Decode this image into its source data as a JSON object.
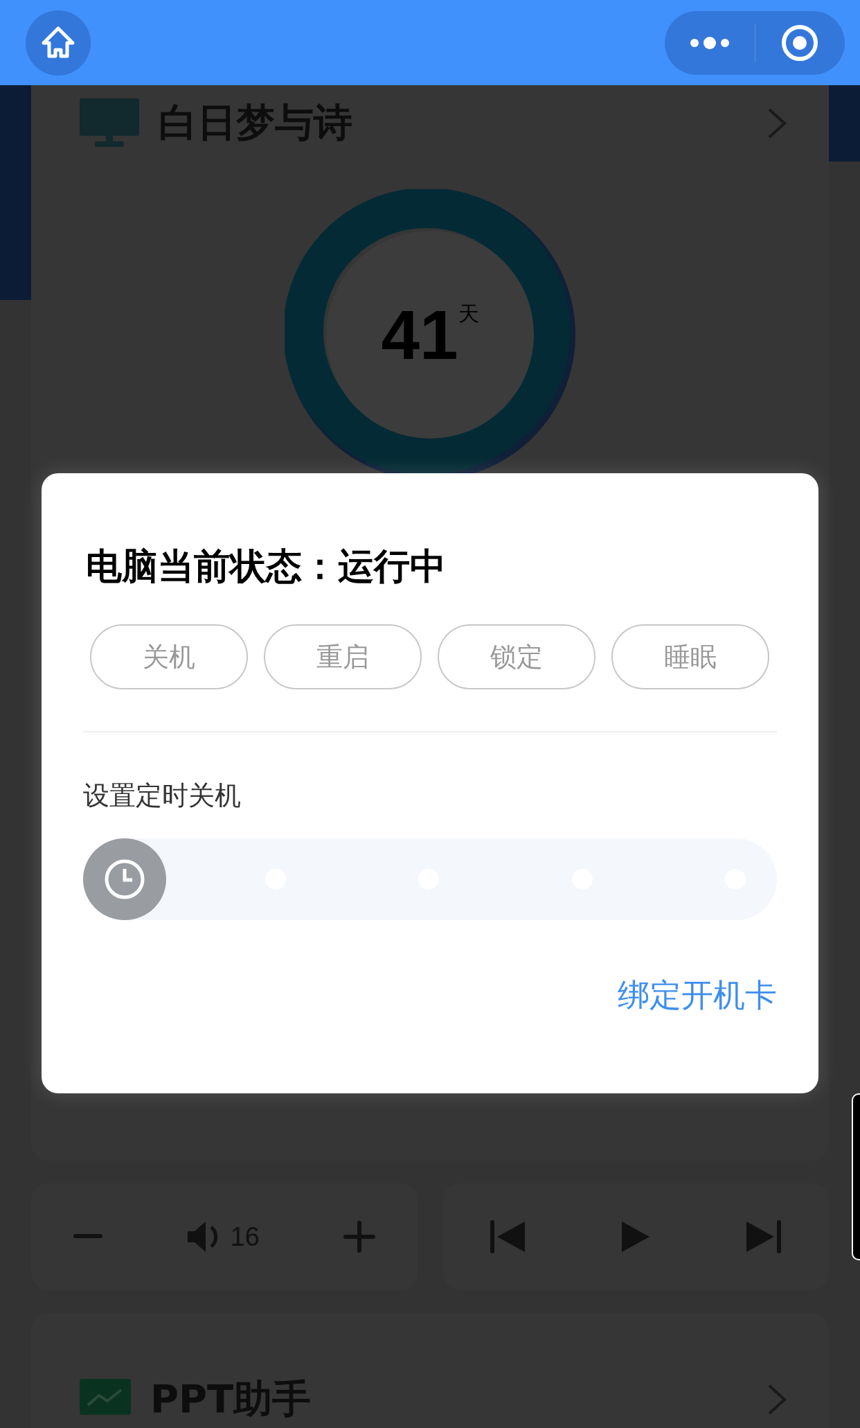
{
  "device_card": {
    "title": "白日梦与诗",
    "days": "41",
    "days_unit": "天"
  },
  "dialog": {
    "title": "电脑当前状态：运行中",
    "actions": [
      "关机",
      "重启",
      "锁定",
      "睡眠"
    ],
    "timer_label": "设置定时关机",
    "timer_slider": {
      "level": 0
    },
    "link": "绑定开机卡"
  },
  "volume": {
    "value": "16"
  },
  "ppt_card": {
    "title": "PPT助手"
  }
}
